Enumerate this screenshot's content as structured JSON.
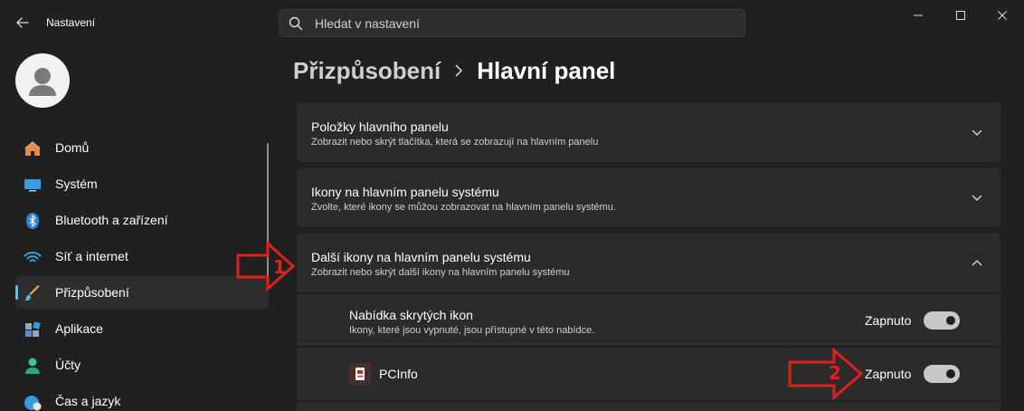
{
  "window": {
    "title": "Nastavení"
  },
  "search": {
    "placeholder": "Hledat v nastavení"
  },
  "sidebar": {
    "items": [
      {
        "label": "Domů",
        "icon": "home-icon"
      },
      {
        "label": "Systém",
        "icon": "monitor-icon"
      },
      {
        "label": "Bluetooth a zařízení",
        "icon": "bluetooth-icon"
      },
      {
        "label": "Síť a internet",
        "icon": "wifi-icon"
      },
      {
        "label": "Přizpůsobení",
        "icon": "brush-icon",
        "active": true
      },
      {
        "label": "Aplikace",
        "icon": "apps-icon"
      },
      {
        "label": "Účty",
        "icon": "account-icon"
      },
      {
        "label": "Čas a jazyk",
        "icon": "clock-globe-icon"
      }
    ]
  },
  "breadcrumb": {
    "parent": "Přizpůsobení",
    "current": "Hlavní panel"
  },
  "sections": [
    {
      "title": "Položky hlavního panelu",
      "description": "Zobrazit nebo skrýt tlačítka, která se zobrazují na hlavním panelu",
      "expanded": false
    },
    {
      "title": "Ikony na hlavním panelu systému",
      "description": "Zvolte, které ikony se můžou zobrazovat na hlavním panelu systému.",
      "expanded": false
    },
    {
      "title": "Další ikony na hlavním panelu systému",
      "description": "Zobrazit nebo skrýt další ikony na hlavním panelu systému",
      "expanded": true,
      "rows": [
        {
          "title": "Nabídka skrytých ikon",
          "description": "Ikony, které jsou vypnuté, jsou přístupné v této nabídce.",
          "state_label": "Zapnuto",
          "on": true
        },
        {
          "title": "PCInfo",
          "state_label": "Zapnuto",
          "on": true,
          "icon": "pcinfo-app-icon"
        }
      ]
    }
  ],
  "annotations": [
    {
      "label": "1"
    },
    {
      "label": "2"
    }
  ],
  "colors": {
    "background": "#202020",
    "card": "#2b2b2b",
    "accent": "#4cc2ff",
    "annotation": "#e0201c"
  }
}
